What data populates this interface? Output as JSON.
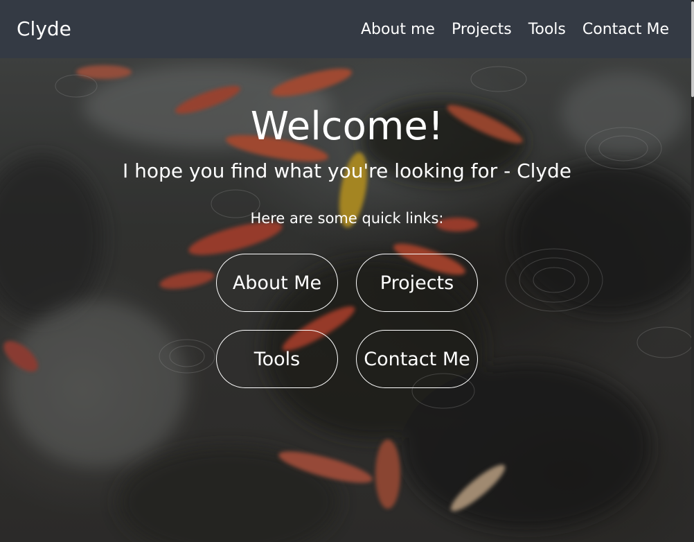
{
  "navbar": {
    "brand": "Clyde",
    "links": [
      "About me",
      "Projects",
      "Tools",
      "Contact Me"
    ]
  },
  "hero": {
    "title": "Welcome!",
    "subtitle": "I hope you find what you're looking for - Clyde",
    "quick_links_label": "Here are some quick links:",
    "buttons": [
      "About Me",
      "Projects",
      "Tools",
      "Contact Me"
    ]
  },
  "colors": {
    "navbar_bg": "#343a44",
    "text": "#ffffff"
  }
}
